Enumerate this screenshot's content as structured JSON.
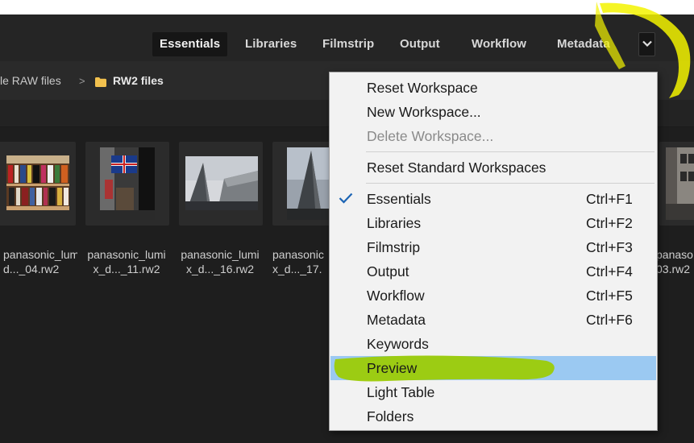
{
  "workspace_tabs": [
    {
      "label": "Essentials",
      "active": true
    },
    {
      "label": "Libraries",
      "active": false
    },
    {
      "label": "Filmstrip",
      "active": false
    },
    {
      "label": "Output",
      "active": false
    },
    {
      "label": "Workflow",
      "active": false
    },
    {
      "label": "Metadata",
      "active": false
    }
  ],
  "breadcrumb": {
    "parent": "le RAW files",
    "separator": ">",
    "current": "RW2 files"
  },
  "thumbnails": [
    {
      "line1": "panasonic_lumi",
      "line2": "d..._04.rw2"
    },
    {
      "line1": "panasonic_lumi",
      "line2": "x_d..._11.rw2"
    },
    {
      "line1": "panasonic_lumi",
      "line2": "x_d..._16.rw2"
    },
    {
      "line1": "panasonic",
      "line2": "x_d..._17."
    },
    {
      "line1": "panaso",
      "line2": "03.rw2"
    }
  ],
  "menu": {
    "items": [
      {
        "label": "Reset Workspace",
        "shortcut": "",
        "disabled": false
      },
      {
        "label": "New Workspace...",
        "shortcut": "",
        "disabled": false
      },
      {
        "label": "Delete Workspace...",
        "shortcut": "",
        "disabled": true
      },
      {
        "label": "Reset Standard Workspaces",
        "shortcut": "",
        "disabled": false
      },
      {
        "label": "Essentials",
        "shortcut": "Ctrl+F1",
        "checked": true
      },
      {
        "label": "Libraries",
        "shortcut": "Ctrl+F2"
      },
      {
        "label": "Filmstrip",
        "shortcut": "Ctrl+F3"
      },
      {
        "label": "Output",
        "shortcut": "Ctrl+F4"
      },
      {
        "label": "Workflow",
        "shortcut": "Ctrl+F5"
      },
      {
        "label": "Metadata",
        "shortcut": "Ctrl+F6"
      },
      {
        "label": "Keywords",
        "shortcut": ""
      },
      {
        "label": "Preview",
        "shortcut": "",
        "highlighted": true
      },
      {
        "label": "Light Table",
        "shortcut": ""
      },
      {
        "label": "Folders",
        "shortcut": ""
      }
    ]
  },
  "icons": {
    "chevron": "chevron-down-icon",
    "folder": "folder-icon",
    "check": "checkmark-icon"
  },
  "colors": {
    "app_bg": "#1f1f1f",
    "menu_bg": "#f2f2f2",
    "menu_highlight": "#9bc9f2",
    "marker_yellow": "#f3f300",
    "marker_green": "#9ccc00",
    "folder": "#f2c14e"
  }
}
